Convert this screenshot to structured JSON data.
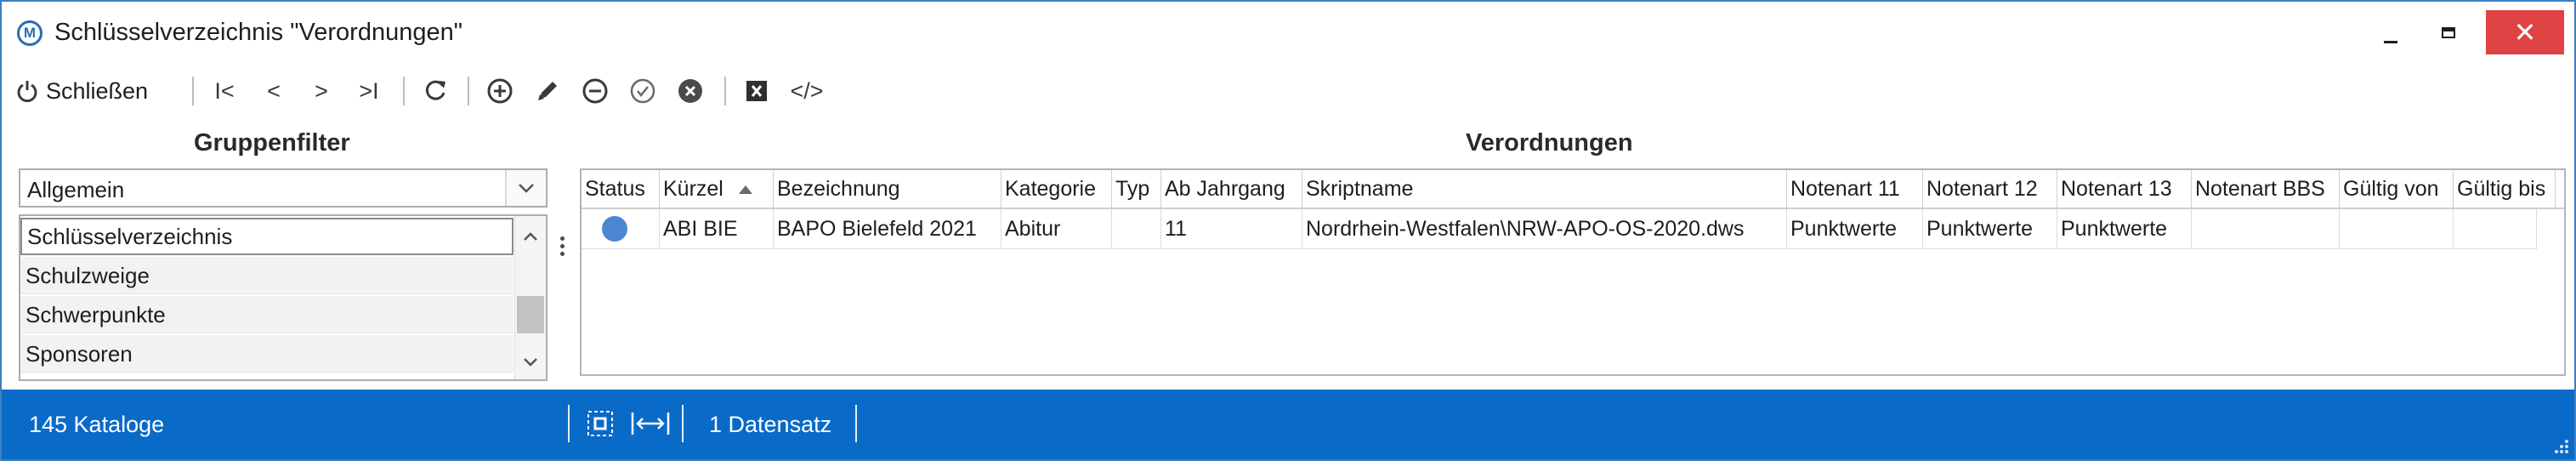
{
  "window": {
    "logo_letter": "M",
    "title": "Schlüsselverzeichnis \"Verordnungen\"",
    "close_glyph": "✕"
  },
  "toolbar": {
    "close_label": "Schließen",
    "first_label": "I<",
    "prev_label": "<",
    "next_label": ">",
    "last_label": ">I",
    "code_label": "</>"
  },
  "left_panel": {
    "title": "Gruppenfilter",
    "dropdown_value": "Allgemein",
    "items": [
      {
        "label": "Schlüsselverzeichnis",
        "selected": true
      },
      {
        "label": "Schulzweige",
        "selected": false
      },
      {
        "label": "Schwerpunkte",
        "selected": false
      },
      {
        "label": "Sponsoren",
        "selected": false
      }
    ]
  },
  "main": {
    "title": "Verordnungen",
    "columns": [
      "Status",
      "Kürzel",
      "Bezeichnung",
      "Kategorie",
      "Typ",
      "Ab Jahrgang",
      "Skriptname",
      "Notenart 11",
      "Notenart 12",
      "Notenart 13",
      "Notenart BBS",
      "Gültig von",
      "Gültig bis"
    ],
    "sort_column": "Kürzel",
    "sort_direction": "ascending",
    "rows": [
      {
        "status_color": "#4b88d1",
        "cells": [
          "",
          "ABI BIE",
          "BAPO Bielefeld 2021",
          "Abitur",
          "",
          "11",
          "Nordrhein-Westfalen\\NRW-APO-OS-2020.dws",
          "Punktwerte",
          "Punktwerte",
          "Punktwerte",
          "",
          "",
          ""
        ]
      }
    ]
  },
  "statusbar": {
    "catalog_count": "145 Kataloge",
    "record_count": "1 Datensatz"
  },
  "colors": {
    "window_border": "#3d7fc3",
    "statusbar_bg": "#0a6ac8",
    "close_button": "#e04343",
    "status_dot": "#4b88d1"
  }
}
